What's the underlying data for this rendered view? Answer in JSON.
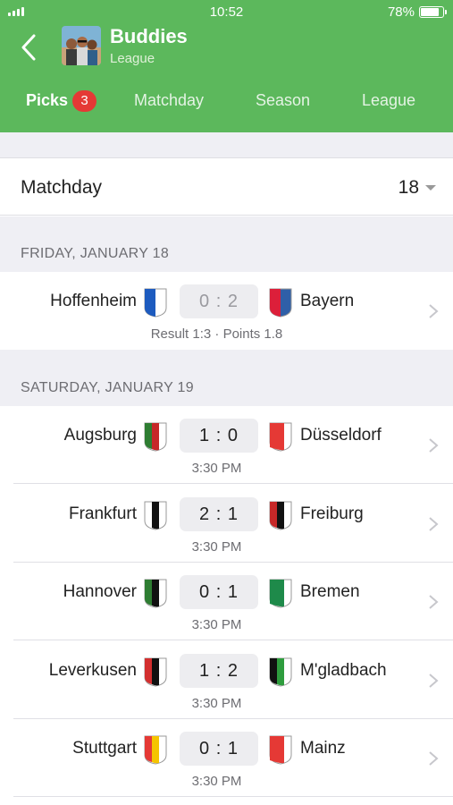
{
  "status_bar": {
    "time": "10:52",
    "battery": "78%"
  },
  "header": {
    "title": "Buddies",
    "subtitle": "League"
  },
  "tabs": [
    {
      "label": "Picks",
      "badge": "3",
      "active": true
    },
    {
      "label": "Matchday"
    },
    {
      "label": "Season"
    },
    {
      "label": "League"
    }
  ],
  "matchday": {
    "label": "Matchday",
    "value": "18"
  },
  "sections": {
    "friday": "FRIDAY, JANUARY 18",
    "saturday": "SATURDAY, JANUARY 19"
  },
  "matches": [
    {
      "home": "Hoffenheim",
      "away": "Bayern",
      "score": "0 : 2",
      "info": "Result 1:3 · Points 1.8"
    },
    {
      "home": "Augsburg",
      "away": "Düsseldorf",
      "score": "1 : 0",
      "info": "3:30 PM"
    },
    {
      "home": "Frankfurt",
      "away": "Freiburg",
      "score": "2 : 1",
      "info": "3:30 PM"
    },
    {
      "home": "Hannover",
      "away": "Bremen",
      "score": "0 : 1",
      "info": "3:30 PM"
    },
    {
      "home": "Leverkusen",
      "away": "M'gladbach",
      "score": "1 : 2",
      "info": "3:30 PM"
    },
    {
      "home": "Stuttgart",
      "away": "Mainz",
      "score": "0 : 1",
      "info": "3:30 PM"
    }
  ],
  "colors": {
    "header_green": "#5cb85c",
    "badge_red": "#e53935",
    "section_gray": "#efeff4"
  }
}
